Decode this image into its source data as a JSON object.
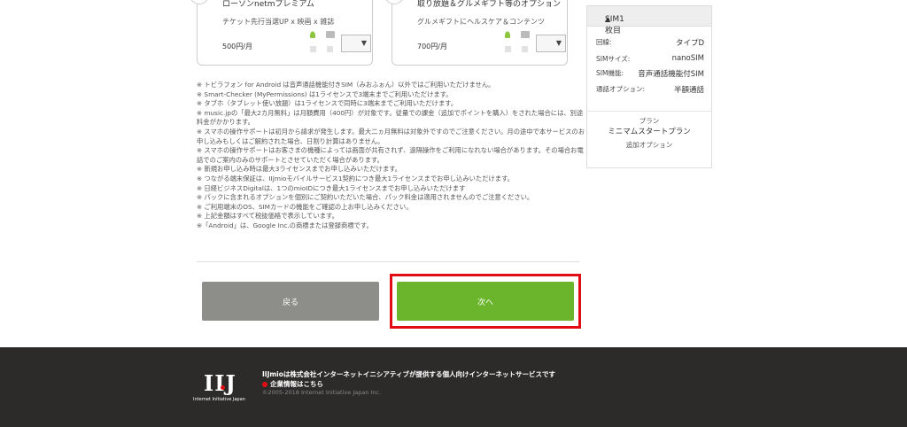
{
  "cards": [
    {
      "title": "ローソンnetmプレミアム",
      "desc": "チケット先行当選UP x 映画 x 雑誌",
      "price": "500円/月",
      "select_icon": "chevron-down-icon",
      "select_glyph": "▼"
    },
    {
      "title": "取り放題＆グルメギフト等のオプション",
      "desc": "グルメギフトにヘルスケア＆コンテンツ",
      "price": "700円/月",
      "select_icon": "chevron-down-icon",
      "select_glyph": "▼"
    }
  ],
  "notes": [
    "※ トビラフォン for Android は音声通話機能付きSIM（みおふぉん）以外ではご利用いただけません。",
    "※ Smart-Checker (MyPermissions) は1ライセンスで3端末までご利用いただけます。",
    "※ タブホ（タブレット使い放題）は1ライセンスで同時に3端末までご利用いただけます。",
    "※ music.jpの「最大2カ月無料」は月額費用（400円）が対象です。従量での課金（追加でポイントを購入）をされた場合には、別途料金がかかります。",
    "※ スマホの操作サポートは初月から請求が発生します。最大二ヵ月無料は対象外ですのでご注意ください。月の途中で本サービスのお申し込みもしくはご解約された場合、日割り計算はありません。",
    "※ スマホの操作サポートはお客さまの機種によっては画面が共有されず、遠隔操作をご利用になれない場合があります。その場合お電話でのご案内のみのサポートとさせていただく場合があります。",
    "※ 新規お申し込み時は最大3ライセンスまでお申し込みいただけます。",
    "※ つながる端末保証は、IIJmioモバイルサービス1契約につき最大1ライセンスまでお申し込みいただけます。",
    "※ 日経ビジネスDigitalは、1つのmioIDにつき最大1ライセンスまでお申し込みいただけます",
    "※ パックに含まれるオプションを個別にご契約いただいた場合、パック料金は適用されませんのでご注意ください。",
    "※ ご利用端末のOS、SIMカードの機能をご確認の上お申し込みください。",
    "※ 上記金額はすべて税抜価格で表示しています。",
    "※「Android」は、Google Inc.の商標または登録商標です。"
  ],
  "buttons": {
    "back": "戻る",
    "next": "次へ"
  },
  "sidebar": {
    "title": "SIM1枚目",
    "toggle_glyph": "▲",
    "rows": [
      {
        "key": "回線:",
        "value": "タイプD"
      },
      {
        "key": "SIMサイズ:",
        "value": "nanoSIM"
      },
      {
        "key": "SIM機能:",
        "value": "音声通話機能付SIM"
      },
      {
        "key": "通話オプション:",
        "value": "半額通話"
      }
    ],
    "plan_label": "プラン",
    "plan_value": "ミニマムスタートプラン",
    "option_label": "追加オプション"
  },
  "footer": {
    "logo_mark": "IIJ",
    "logo_sub": "Internet Initiative Japan",
    "tagline": "IIJmioは株式会社インターネットイニシアティブが提供する個人向けインターネットサービスです",
    "company_link": "企業情報はこちら",
    "copyright": "©2005-2018 Internet Initiative Japan Inc."
  },
  "colors": {
    "next": "#6bb52c",
    "back": "#8d8d89",
    "highlight": "#e10d14",
    "footer_bg": "#2d2a2a"
  }
}
